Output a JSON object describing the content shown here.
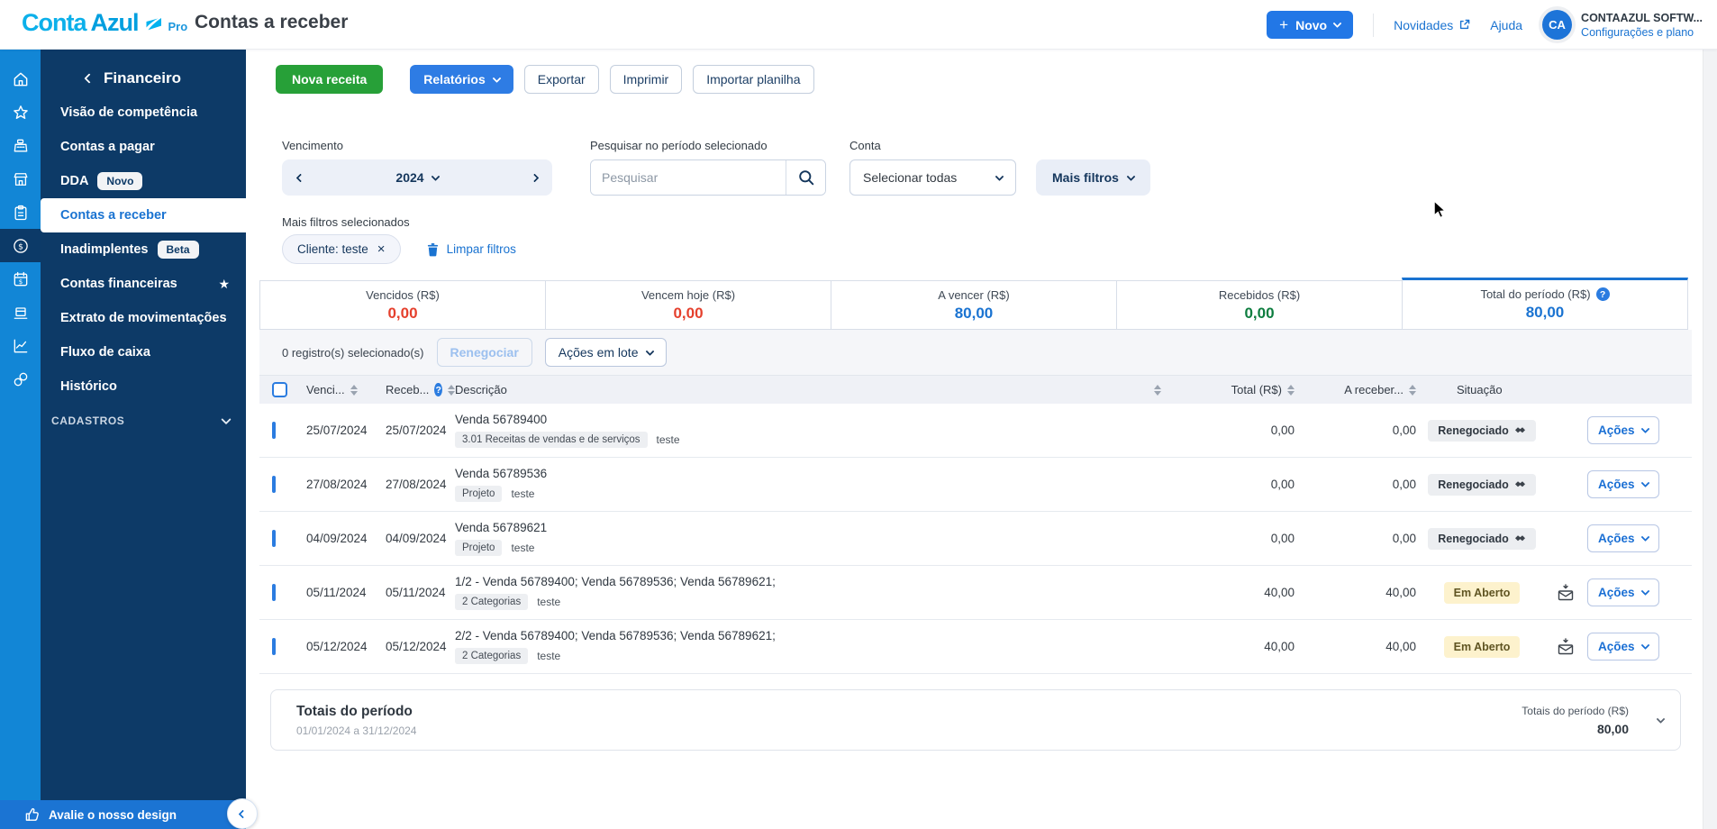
{
  "header": {
    "logo_conta": "Conta",
    "logo_azul": "Azul",
    "logo_pro": "Pro",
    "page_title": "Contas a receber",
    "novo_label": "Novo",
    "novidades": "Novidades",
    "ajuda": "Ajuda",
    "avatar_initials": "CA",
    "account_name": "CONTAAZUL SOFTW...",
    "account_settings": "Configurações e plano"
  },
  "sidebar": {
    "section_title": "Financeiro",
    "items": [
      {
        "label": "Visão de competência"
      },
      {
        "label": "Contas a pagar"
      },
      {
        "label": "DDA",
        "badge": "Novo"
      },
      {
        "label": "Contas a receber",
        "active": true
      },
      {
        "label": "Inadimplentes",
        "badge": "Beta"
      },
      {
        "label": "Contas financeiras",
        "starred": true
      },
      {
        "label": "Extrato de movimentações"
      },
      {
        "label": "Fluxo de caixa"
      },
      {
        "label": "Histórico"
      }
    ],
    "cadastros": "CADASTROS",
    "rate_label": "Avalie o nosso design",
    "rail_icons": [
      "home",
      "star",
      "cash-register",
      "store",
      "clipboard",
      "coin",
      "calendar-money",
      "delivery-box",
      "chart-line",
      "link"
    ]
  },
  "toolbar": {
    "nova_receita": "Nova receita",
    "relatorios": "Relatórios",
    "exportar": "Exportar",
    "imprimir": "Imprimir",
    "importar_planilha": "Importar planilha"
  },
  "filters": {
    "vencimento_label": "Vencimento",
    "year": "2024",
    "search_label": "Pesquisar no período selecionado",
    "search_placeholder": "Pesquisar",
    "conta_label": "Conta",
    "conta_value": "Selecionar todas",
    "mais_filtros": "Mais filtros"
  },
  "selected_filters": {
    "title": "Mais filtros selecionados",
    "chip": "Cliente: teste",
    "limpar": "Limpar filtros"
  },
  "summary_cards": [
    {
      "label": "Vencidos (R$)",
      "value": "0,00",
      "color": "red"
    },
    {
      "label": "Vencem hoje (R$)",
      "value": "0,00",
      "color": "red"
    },
    {
      "label": "A vencer (R$)",
      "value": "80,00",
      "color": "blue"
    },
    {
      "label": "Recebidos (R$)",
      "value": "0,00",
      "color": "green"
    },
    {
      "label": "Total do período (R$)",
      "value": "80,00",
      "color": "blue",
      "selected": true,
      "help": true
    }
  ],
  "bulk_bar": {
    "selected_text": "0 registro(s) selecionado(s)",
    "renegociar": "Renegociar",
    "acoes_em_lote": "Ações em lote"
  },
  "table": {
    "columns": {
      "venc": "Venci...",
      "receb": "Receb...",
      "desc": "Descrição",
      "total": "Total (R$)",
      "a_receber": "A receber...",
      "situacao": "Situação"
    },
    "acoes_label": "Ações",
    "rows": [
      {
        "venc": "25/07/2024",
        "receb": "25/07/2024",
        "desc": "Venda 56789400",
        "tag": "3.01 Receitas de vendas e de serviços",
        "tag2": "teste",
        "total": "0,00",
        "a_receber": "0,00",
        "status": "Renegociado",
        "status_type": "renegociado",
        "has_mail": false
      },
      {
        "venc": "27/08/2024",
        "receb": "27/08/2024",
        "desc": "Venda 56789536",
        "tag": "Projeto",
        "tag2": "teste",
        "total": "0,00",
        "a_receber": "0,00",
        "status": "Renegociado",
        "status_type": "renegociado",
        "has_mail": false
      },
      {
        "venc": "04/09/2024",
        "receb": "04/09/2024",
        "desc": "Venda 56789621",
        "tag": "Projeto",
        "tag2": "teste",
        "total": "0,00",
        "a_receber": "0,00",
        "status": "Renegociado",
        "status_type": "renegociado",
        "has_mail": false
      },
      {
        "venc": "05/11/2024",
        "receb": "05/11/2024",
        "desc": "1/2 - Venda 56789400; Venda 56789536; Venda 56789621;",
        "tag": "2 Categorias",
        "tag2": "teste",
        "total": "40,00",
        "a_receber": "40,00",
        "status": "Em Aberto",
        "status_type": "aberto",
        "has_mail": true
      },
      {
        "venc": "05/12/2024",
        "receb": "05/12/2024",
        "desc": "2/2 - Venda 56789400; Venda 56789536; Venda 56789621;",
        "tag": "2 Categorias",
        "tag2": "teste",
        "total": "40,00",
        "a_receber": "40,00",
        "status": "Em Aberto",
        "status_type": "aberto",
        "has_mail": true
      }
    ]
  },
  "footer_totals": {
    "title": "Totais do período",
    "period": "01/01/2024 a 31/12/2024",
    "right_label": "Totais do período (R$)",
    "right_value": "80,00"
  },
  "colors": {
    "accent_blue": "#1a73d1",
    "rail_blue": "#1286d6",
    "navy": "#0d3a67",
    "green_button": "#27a038",
    "red_value": "#e5402d",
    "green_value": "#0d7d3f",
    "open_badge_bg": "#fdf2cd"
  }
}
